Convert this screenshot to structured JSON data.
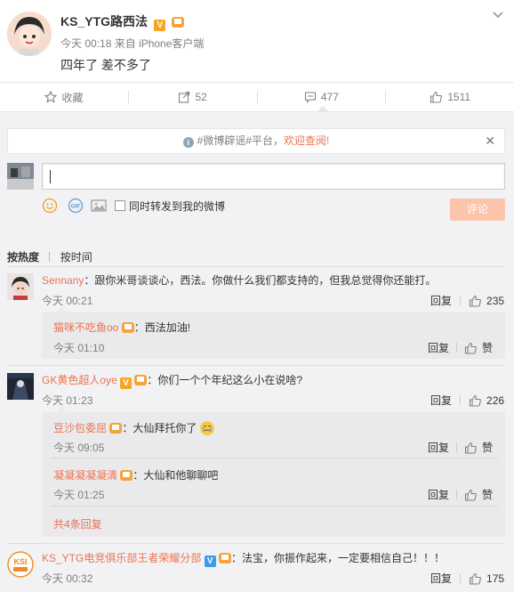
{
  "post": {
    "username": "KS_YTG路西法",
    "meta": "今天 00:18 来自 iPhone客户端",
    "content": "四年了 差不多了"
  },
  "actions": {
    "favorite": "收藏",
    "repost": "52",
    "comment": "477",
    "like": "1511"
  },
  "notice": {
    "tag_text": "#微博辟谣#平台，",
    "link_text": "欢迎查阅!"
  },
  "composer": {
    "repost_checkbox_label": "同时转发到我的微博",
    "submit_label": "评论"
  },
  "sort": {
    "hot": "按热度",
    "time": "按时间"
  },
  "comments": [
    {
      "user": "Sennany",
      "text": "：跟你米哥谈谈心，西法。你做什么我们都支持的，但我总觉得你还能打。",
      "time": "今天 00:21",
      "reply": "回复",
      "likes": "235",
      "replies": [
        {
          "user": "猫咪不吃鱼oo",
          "text": "：西法加油!",
          "time": "今天 01:10",
          "reply": "回复",
          "likes": "赞"
        }
      ]
    },
    {
      "user": "GK黄色超人oye",
      "text": "：你们一个个年纪这么小在说啥?",
      "time": "今天 01:23",
      "reply": "回复",
      "likes": "226",
      "replies": [
        {
          "user": "豆沙包委屈",
          "text": "：大仙拜托你了",
          "time": "今天 09:05",
          "reply": "回复",
          "likes": "赞"
        },
        {
          "user": "凝凝凝凝凝清",
          "text": "：大仙和他聊聊吧",
          "time": "今天 01:25",
          "reply": "回复",
          "likes": "赞"
        }
      ],
      "more": "共4条回复"
    },
    {
      "user": "KS_YTG电竞俱乐部王者荣耀分部",
      "text": "：法宝，你振作起来，一定要相信自己！！！",
      "time": "今天 00:32",
      "reply": "回复",
      "likes": "175"
    }
  ]
}
